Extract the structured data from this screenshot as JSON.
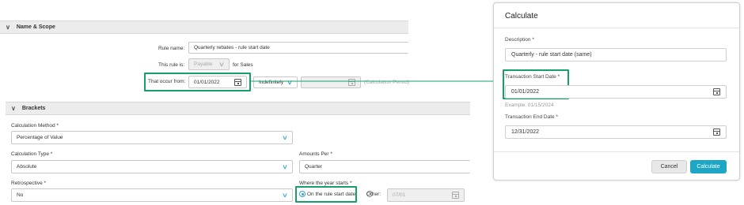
{
  "name_scope": {
    "title": "Name & Scope",
    "rule_name_label": "Rule name:",
    "rule_name_value": "Quarterly rebates - rule start date",
    "rule_is_label": "This rule is:",
    "rule_is_value": "Payable",
    "rule_is_suffix": "for Sales",
    "occur_label": "That occur from:",
    "occur_date": "01/01/2022",
    "occur_duration": "Indefinitely",
    "occur_end_placeholder": "",
    "calc_period": "(Calculation Period)"
  },
  "brackets": {
    "title": "Brackets",
    "calc_method_label": "Calculation Method *",
    "calc_method_value": "Percentage of Value",
    "calc_type_label": "Calculation Type *",
    "calc_type_value": "Absolute",
    "amounts_per_label": "Amounts Per *",
    "amounts_per_value": "Quarter",
    "retro_label": "Retrospective *",
    "retro_value": "No",
    "year_starts_label": "Where the year starts *",
    "year_option_rule": "On the rule start date",
    "year_option_other": "Other:",
    "year_other_value": "07/01"
  },
  "dialog": {
    "title": "Calculate",
    "description_label": "Description *",
    "description_value": "Quarterly - rule start date (same)",
    "start_label": "Transaction Start Date *",
    "start_value": "01/01/2022",
    "start_example": "Example: 01/15/2024",
    "end_label": "Transaction End Date *",
    "end_value": "12/31/2022",
    "cancel_label": "Cancel",
    "calculate_label": "Calculate"
  },
  "colors": {
    "highlight": "#15a06a",
    "accent": "#3aa0c8",
    "button_primary": "#1ea7c5"
  },
  "icons": [
    "chevron-down-icon",
    "calendar-icon",
    "radio-icon"
  ]
}
